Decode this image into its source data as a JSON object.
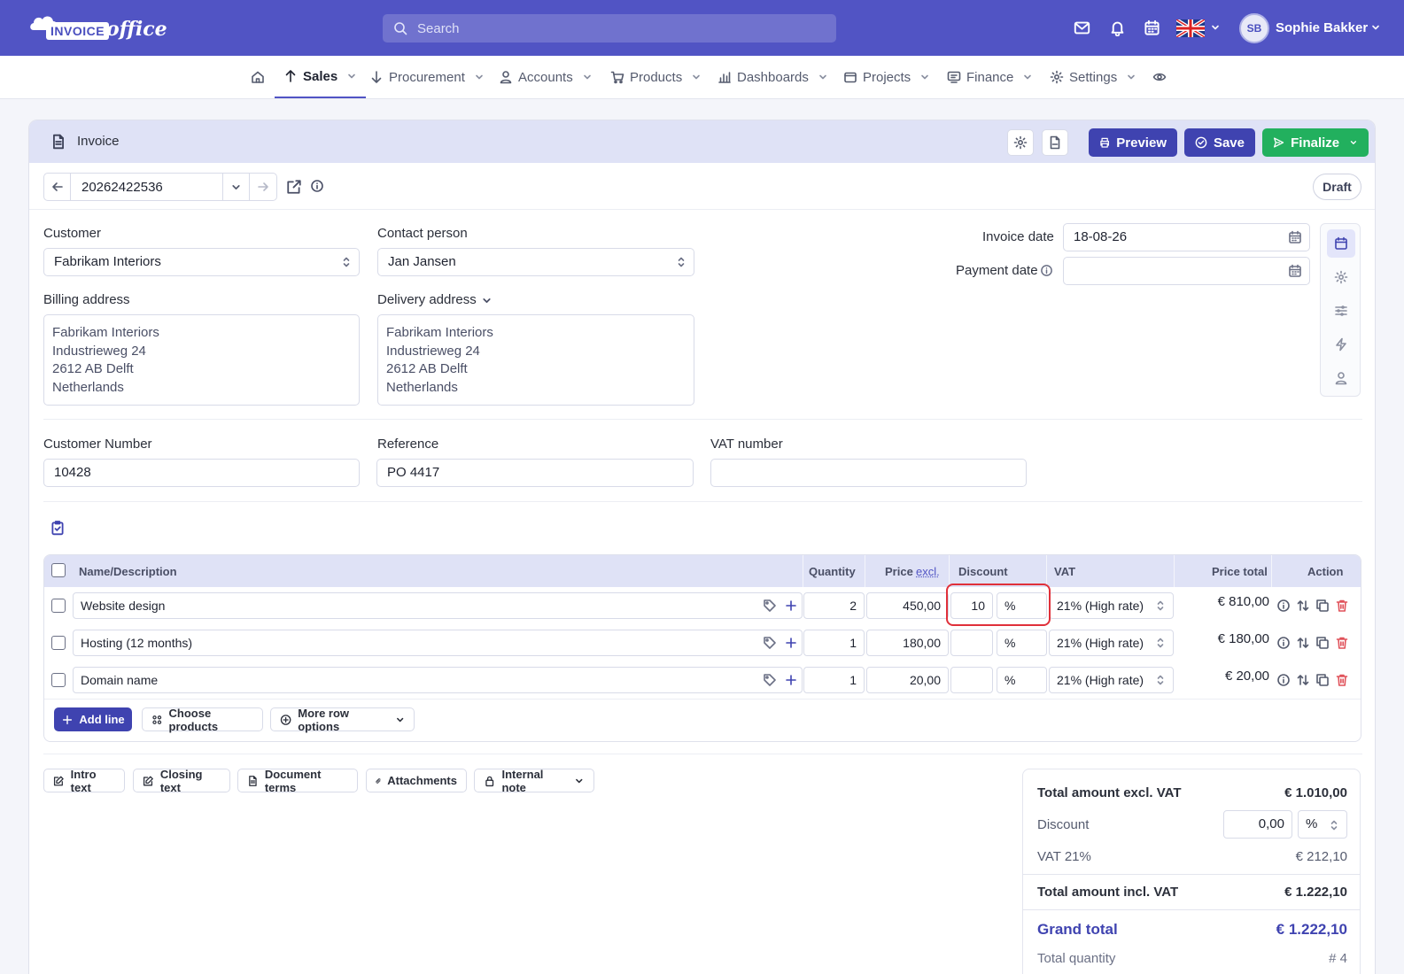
{
  "brand": {
    "logo_part1": "INVOICE",
    "logo_part2": "office",
    "color": "#5154c4"
  },
  "search": {
    "placeholder": "Search"
  },
  "user": {
    "initials": "SB",
    "name": "Sophie Bakker"
  },
  "nav": {
    "items": [
      {
        "label": "Sales",
        "icon": "arrow-up-icon"
      },
      {
        "label": "Procurement",
        "icon": "arrow-down-icon"
      },
      {
        "label": "Accounts",
        "icon": "person-icon"
      },
      {
        "label": "Products",
        "icon": "cart-icon"
      },
      {
        "label": "Dashboards",
        "icon": "bar-chart-icon"
      },
      {
        "label": "Projects",
        "icon": "folder-icon"
      },
      {
        "label": "Finance",
        "icon": "monitor-icon"
      },
      {
        "label": "Settings",
        "icon": "gear-icon"
      }
    ]
  },
  "header": {
    "title": "Invoice",
    "preview": "Preview",
    "save": "Save",
    "finalize": "Finalize"
  },
  "document": {
    "number": "20262422536",
    "status": "Draft"
  },
  "form": {
    "customer_label": "Customer",
    "customer": "Fabrikam Interiors",
    "contact_label": "Contact person",
    "contact": "Jan Jansen",
    "invoice_date_label": "Invoice date",
    "invoice_date": "18-08-26",
    "payment_date_label": "Payment date",
    "payment_date": "",
    "billing_label": "Billing address",
    "billing": [
      "Fabrikam Interiors",
      "Industrieweg 24",
      "2612 AB Delft",
      "Netherlands"
    ],
    "delivery_label": "Delivery address",
    "delivery": [
      "Fabrikam Interiors",
      "Industrieweg 24",
      "2612 AB Delft",
      "Netherlands"
    ],
    "customer_number_label": "Customer Number",
    "customer_number": "10428",
    "reference_label": "Reference",
    "reference": "PO 4417",
    "vat_number_label": "VAT number",
    "vat_number": ""
  },
  "table": {
    "headers": {
      "name": "Name/Description",
      "quantity": "Quantity",
      "price": "Price",
      "price_suffix": "excl.",
      "discount": "Discount",
      "vat": "VAT",
      "total": "Price total",
      "action": "Action"
    },
    "rows": [
      {
        "name": "Website design",
        "qty": "2",
        "price": "450,00",
        "discount": "10",
        "discount_unit": "%",
        "vat": "21% (High rate)",
        "total": "€ 810,00"
      },
      {
        "name": "Hosting (12 months)",
        "qty": "1",
        "price": "180,00",
        "discount": "",
        "discount_unit": "%",
        "vat": "21% (High rate)",
        "total": "€ 180,00"
      },
      {
        "name": "Domain name",
        "qty": "1",
        "price": "20,00",
        "discount": "",
        "discount_unit": "%",
        "vat": "21% (High rate)",
        "total": "€ 20,00"
      }
    ],
    "add_line": "Add line",
    "choose_products": "Choose products",
    "more_row_options": "More row options"
  },
  "footer_buttons": {
    "intro": "Intro text",
    "closing": "Closing text",
    "terms": "Document terms",
    "attachments": "Attachments",
    "internal_note": "Internal note"
  },
  "totals": {
    "excl_label": "Total amount excl. VAT",
    "excl": "€ 1.010,00",
    "discount_label": "Discount",
    "discount_value": "0,00",
    "discount_unit": "%",
    "vat_label": "VAT 21%",
    "vat": "€ 212,10",
    "incl_label": "Total amount incl. VAT",
    "incl": "€ 1.222,10",
    "grand_label": "Grand total",
    "grand": "€ 1.222,10",
    "qty_label": "Total quantity",
    "qty": "# 4"
  }
}
